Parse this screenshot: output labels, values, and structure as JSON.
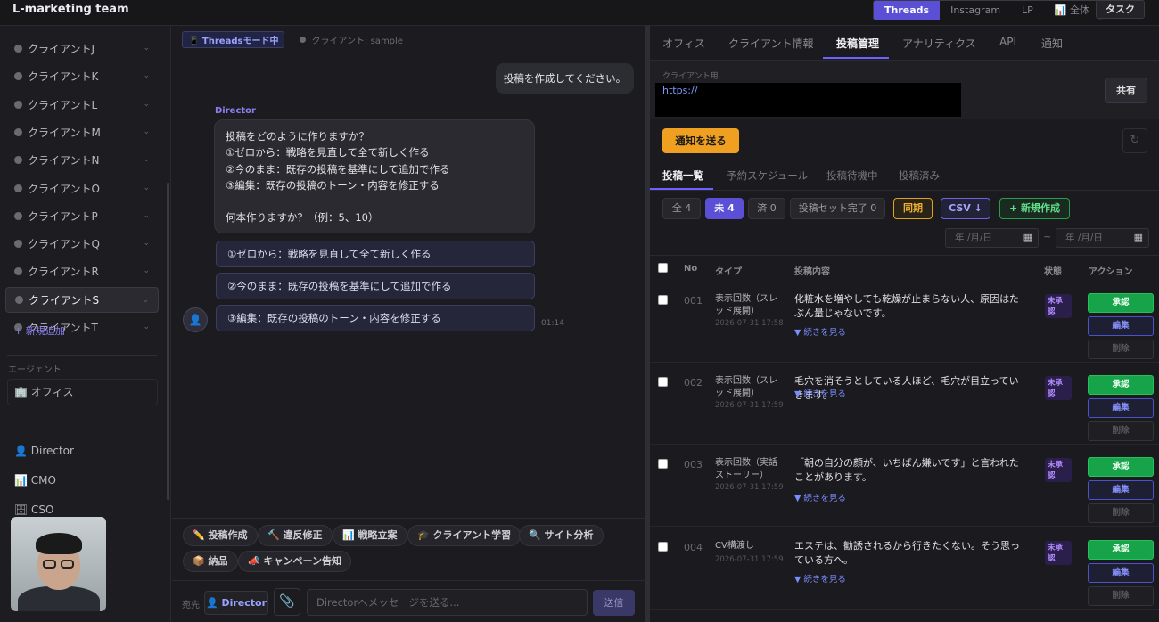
{
  "app_title": "L-marketing team",
  "top_tabs": [
    "Threads",
    "Instagram",
    "LP",
    "📊 全体"
  ],
  "task_label": "タスク",
  "sidebar": {
    "clients": [
      "クライアントJ",
      "クライアントK",
      "クライアントL",
      "クライアントM",
      "クライアントN",
      "クライアントO",
      "クライアントP",
      "クライアントQ",
      "クライアントR",
      "クライアントS",
      "クライアントT"
    ],
    "selected_client": "クライアントS",
    "add_new": "+ 新規追加",
    "agents_heading": "エージェント",
    "office": "🏢 オフィス",
    "agents": [
      "👤 Director",
      "📊 CMO",
      "🗄 CSO"
    ]
  },
  "chat": {
    "mode_badge": "📱 Threadsモード中",
    "client_label": "クライアント: sample",
    "user_message": "投稿を作成してください。",
    "director_label": "Director",
    "director_message": "投稿をどのように作りますか？\n①ゼロから：戦略を見直して全て新しく作る\n②今のまま：既存の投稿を基準にして追加で作る\n③編集：既存の投稿のトーン・内容を修正する\n\n何本作りますか？（例：5、10）",
    "options": [
      "①ゼロから：戦略を見直して全て新しく作る",
      "②今のまま：既存の投稿を基準にして追加で作る",
      "③編集：既存の投稿のトーン・内容を修正する"
    ],
    "time": "01:14",
    "chips": [
      "✏️ 投稿作成",
      "🔨 違反修正",
      "📊 戦略立案",
      "🎓 クライアント学習",
      "🔍 サイト分析",
      "📦 納品",
      "📣 キャンペーン告知"
    ],
    "to_label": "宛先",
    "to_agent": "👤 Director",
    "placeholder": "Directorへメッセージを送る...",
    "send": "送信"
  },
  "panel": {
    "tabs": [
      "オフィス",
      "クライアント情報",
      "投稿管理",
      "アナリティクス",
      "API",
      "通知"
    ],
    "active_tab": "投稿管理",
    "client_label": "クライアント用",
    "url": "https://",
    "share": "共有",
    "notify": "通知を送る",
    "sub_tabs": [
      "投稿一覧",
      "予約スケジュール",
      "投稿待機中",
      "投稿済み"
    ],
    "filters": {
      "all": "全 4",
      "pending": "未 4",
      "done": "済 0",
      "set_done": "投稿セット完了 0",
      "sync": "同期",
      "csv": "CSV ↓",
      "new": "+ 新規作成"
    },
    "date_placeholder": "年 /月/日",
    "headers": {
      "no": "No",
      "type": "タイプ",
      "content": "投稿内容",
      "status": "状態",
      "action": "アクション"
    },
    "rows": [
      {
        "no": "001",
        "type": "表示回数（スレッド展開）",
        "date": "2026-07-31 17:58",
        "text": "化粧水を増やしても乾燥が止まらない人、原因はたぶん量じゃないです。",
        "status": "未承認"
      },
      {
        "no": "002",
        "type": "表示回数（スレッド展開）",
        "date": "2026-07-31 17:59",
        "text": "毛穴を消そうとしている人ほど、毛穴が目立っていきます。",
        "status": "未承認"
      },
      {
        "no": "003",
        "type": "表示回数（実話ストーリー）",
        "date": "2026-07-31 17:59",
        "text": "「朝の自分の顔が、いちばん嫌いです」と言われたことがあります。",
        "status": "未承認"
      },
      {
        "no": "004",
        "type": "CV構渡し",
        "date": "2026-07-31 17:59",
        "text": "エステは、勧誘されるから行きたくない。そう思っている方へ。",
        "status": "未承認"
      }
    ],
    "more": "▼ 続きを見る",
    "actions": {
      "approve": "承認",
      "edit": "編集",
      "delete": "削除"
    }
  }
}
